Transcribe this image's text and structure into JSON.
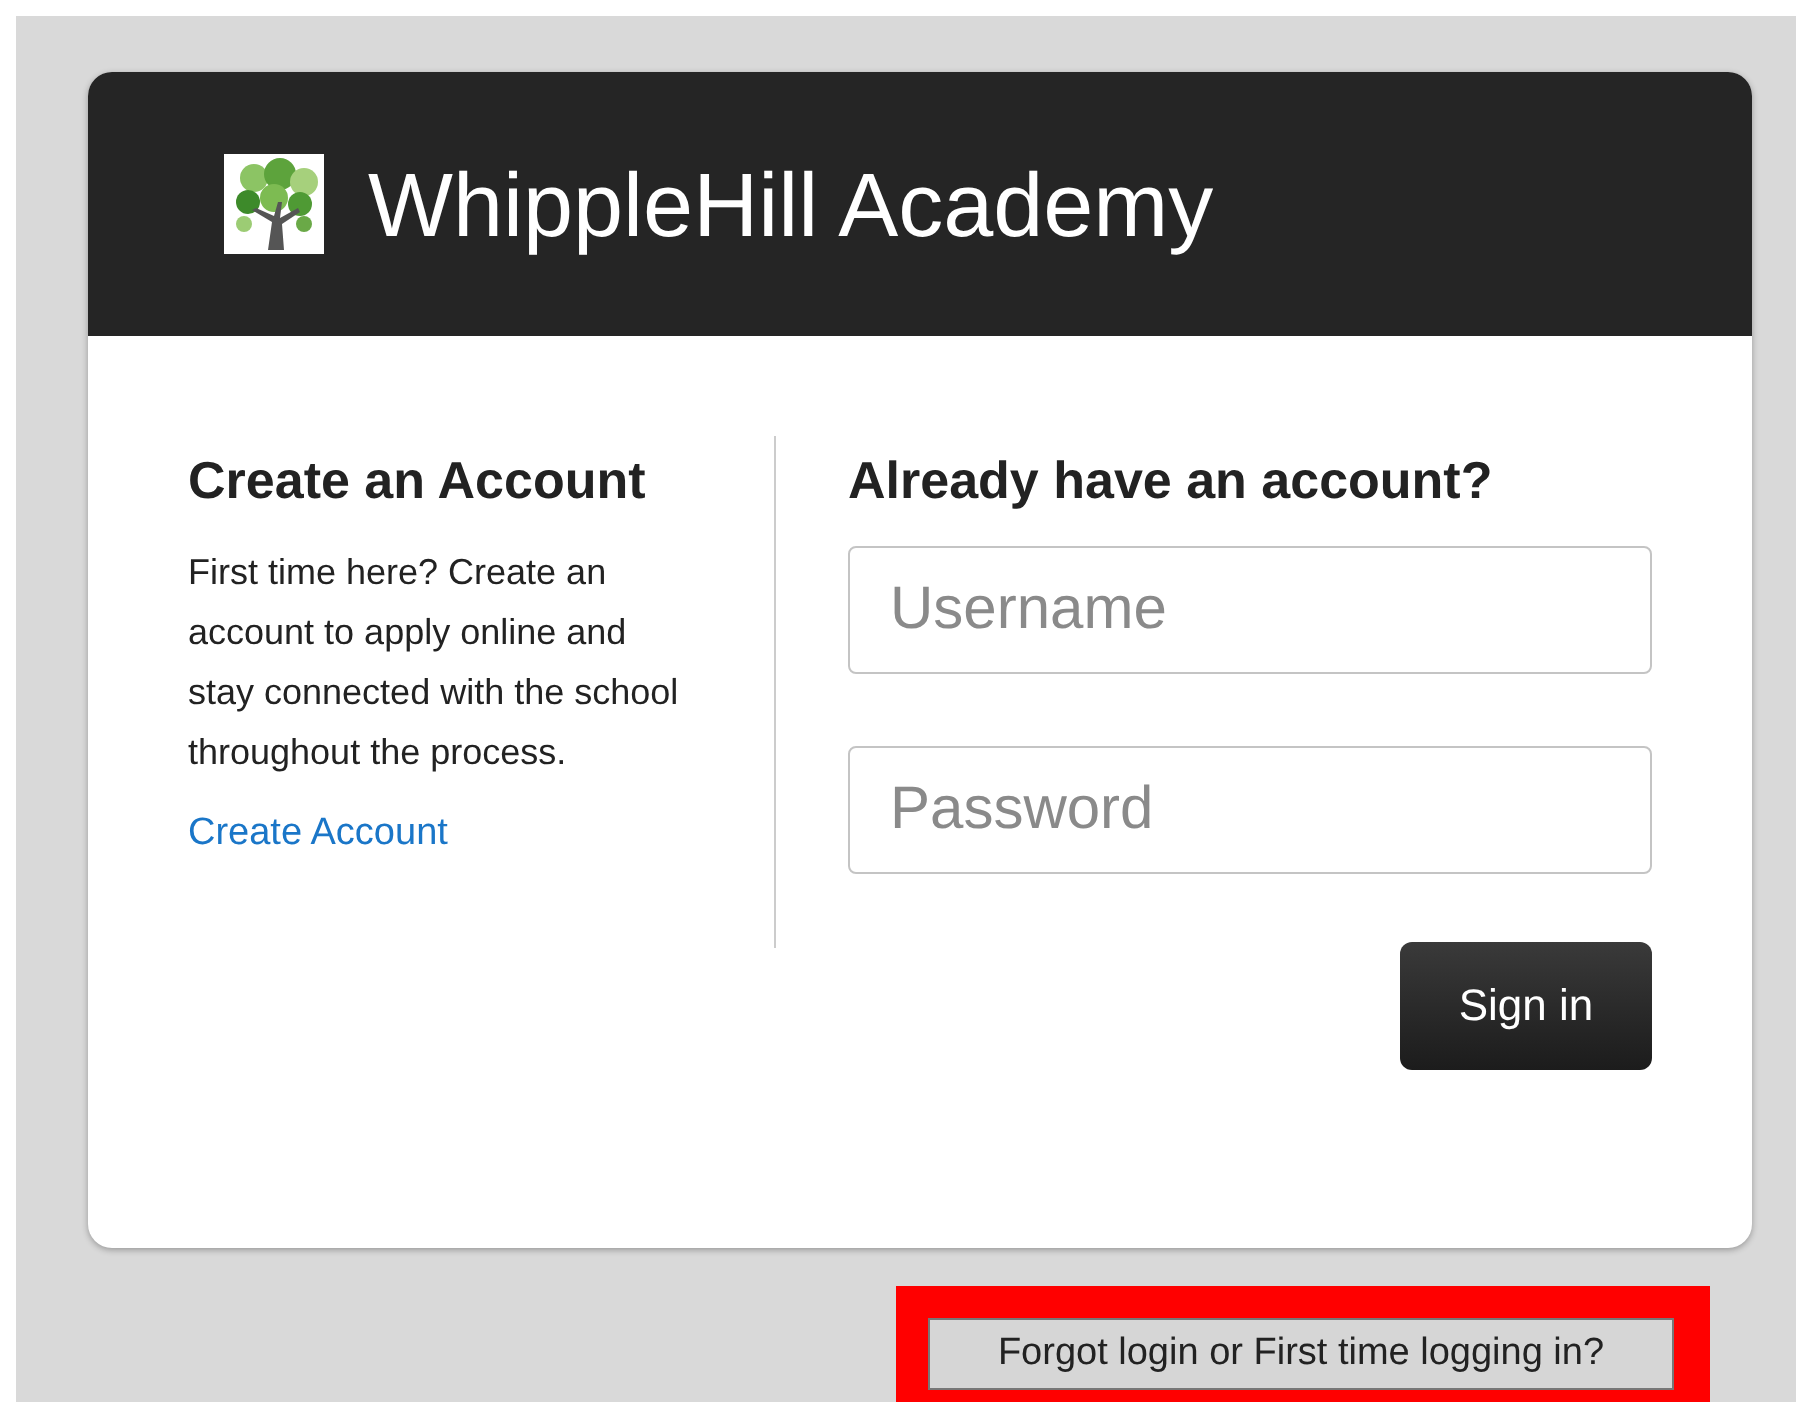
{
  "header": {
    "title": "WhippleHill Academy"
  },
  "create_account": {
    "heading": "Create an Account",
    "text": "First time here? Create an account to apply online and stay connected with the school throughout the process.",
    "link": "Create Account"
  },
  "sign_in": {
    "heading": "Already have an account?",
    "fields": [
      {
        "placeholder": "Username"
      },
      {
        "placeholder": "Password"
      }
    ],
    "button": "Sign in"
  },
  "help_link": {
    "label": "Forgot login or First time logging in?",
    "highlighted": true
  }
}
